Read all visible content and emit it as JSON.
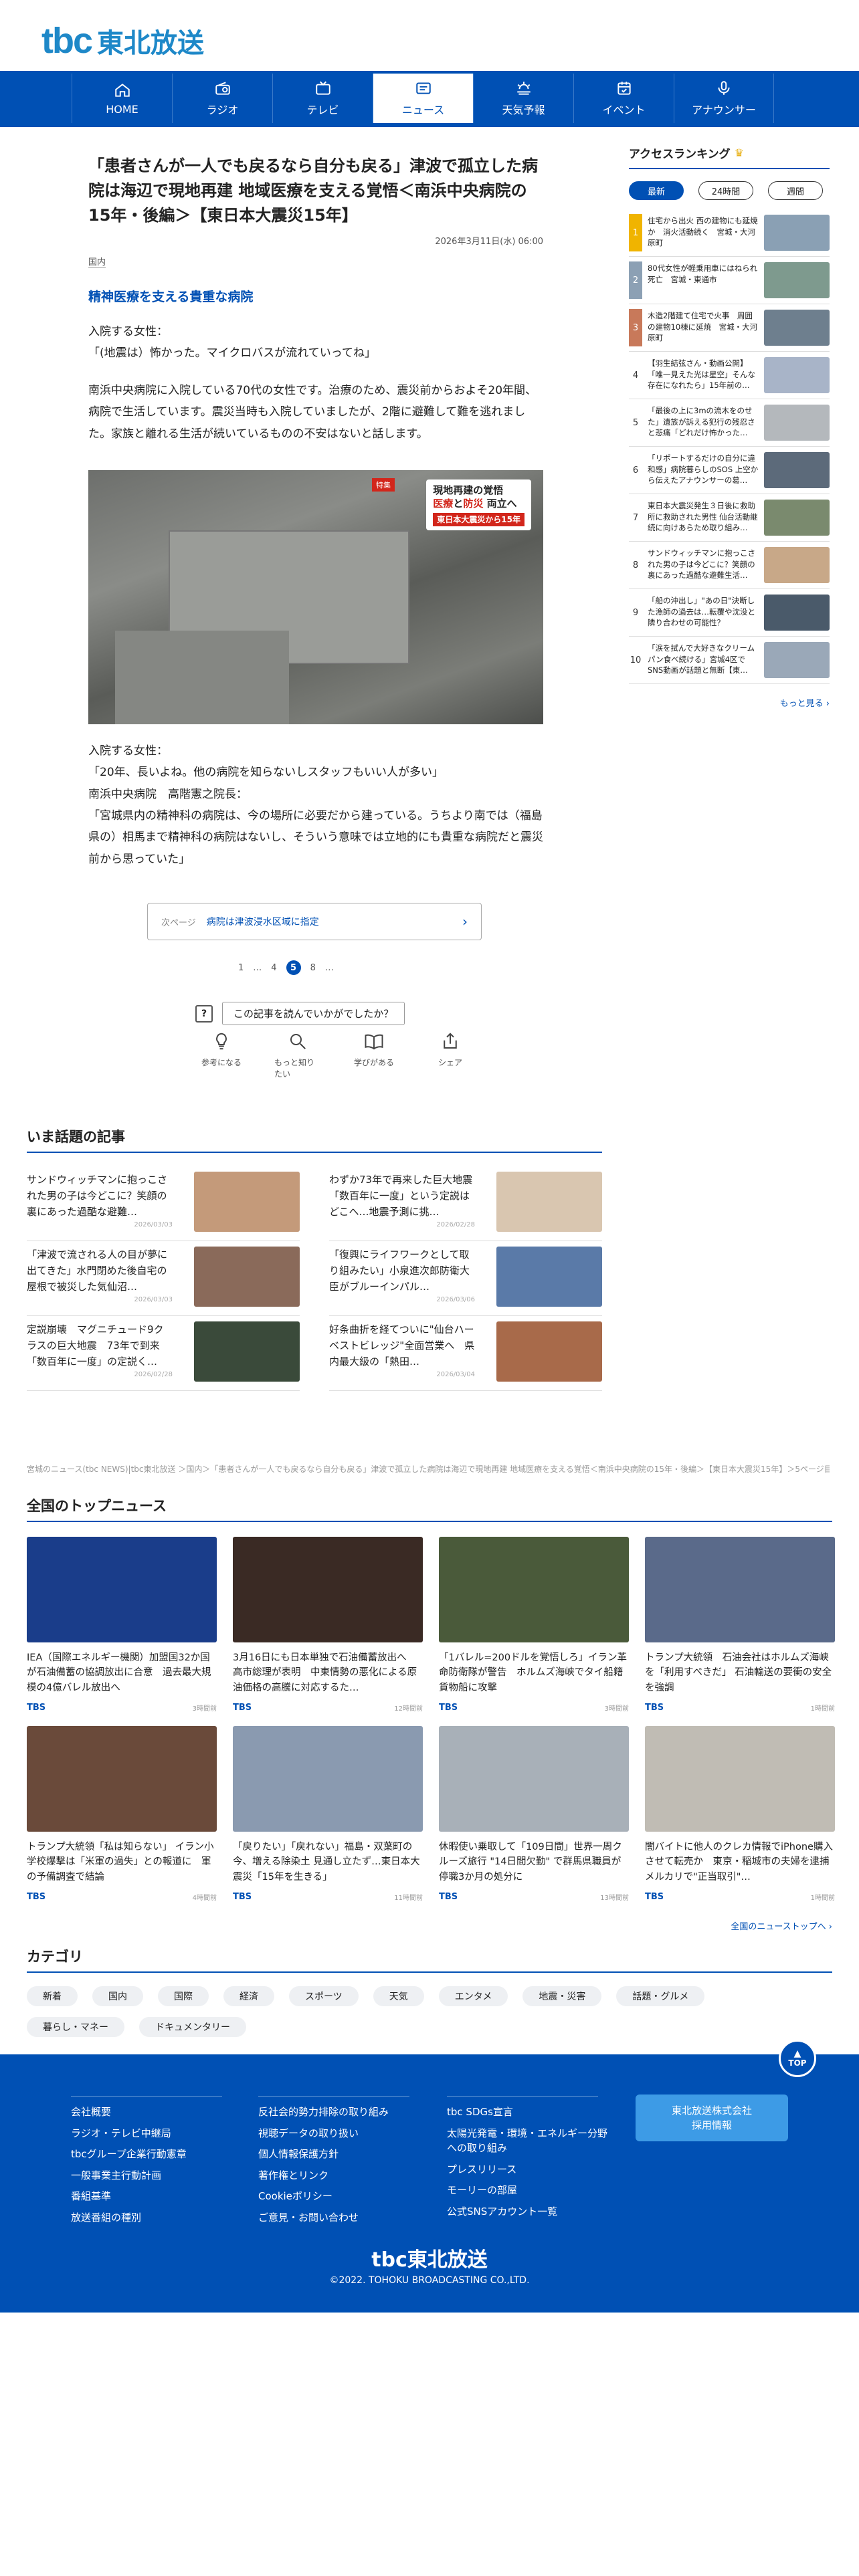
{
  "brand": {
    "logo_mark": "tbc",
    "logo_text": "東北放送"
  },
  "nav": [
    {
      "label": "HOME",
      "icon": "home-icon"
    },
    {
      "label": "ラジオ",
      "icon": "radio-icon"
    },
    {
      "label": "テレビ",
      "icon": "tv-icon"
    },
    {
      "label": "ニュース",
      "icon": "news-icon"
    },
    {
      "label": "天気予報",
      "icon": "weather-icon"
    },
    {
      "label": "イベント",
      "icon": "calendar-icon"
    },
    {
      "label": "アナウンサー",
      "icon": "mic-icon"
    }
  ],
  "article": {
    "title": "「患者さんが一人でも戻るなら自分も戻る」津波で孤立した病院は海辺で現地再建 地域医療を支える覚悟＜南浜中央病院の15年・後編＞【東日本大震災15年】",
    "date": "2026年3月11日(水) 06:00",
    "category": "国内",
    "subheading": "精神医療を支える貴重な病院",
    "quote1": "入院する女性：\n「(地震は）怖かった。マイクロバスが流れていってね」",
    "para1": "南浜中央病院に入院している70代の女性です。治療のため、震災前からおよそ20年間、病院で生活しています。震災当時も入院していましたが、2階に避難して難を逃れました。家族と離れる生活が続いているものの不安はないと話します。",
    "photo_caption_line1": "現地再建の覚悟",
    "photo_caption_line2a": "医療",
    "photo_caption_line2b": "と",
    "photo_caption_line2c": "防災",
    "photo_caption_line2d": " 両立へ",
    "photo_band": "東日本大震災から15年",
    "photo_tag": "特集",
    "quote2": "入院する女性：\n「20年、長いよね。他の病院を知らないしスタッフもいい人が多い」\n南浜中央病院　高階憲之院長：\n「宮城県内の精神科の病院は、今の場所に必要だから建っている。うちより南では（福島県の）相馬まで精神科の病院はないし、そういう意味では立地的にも貴重な病院だと震災前から思っていた」"
  },
  "next": {
    "label": "次ページ",
    "title": "病院は津波浸水区域に指定"
  },
  "pager": {
    "p1": "1",
    "dots1": "…",
    "p4": "4",
    "current": "5",
    "p8": "8",
    "dots2": "…"
  },
  "question": {
    "icon_text": "?",
    "text": "この記事を読んでいかがでしたか？"
  },
  "reactions": [
    {
      "label": "参考になる",
      "icon": "lightbulb-icon"
    },
    {
      "label": "もっと知りたい",
      "icon": "search-icon"
    },
    {
      "label": "学びがある",
      "icon": "book-icon"
    },
    {
      "label": "シェア",
      "icon": "share-icon"
    }
  ],
  "ranking": {
    "title": "アクセスランキング",
    "tabs": [
      "最新",
      "24時間",
      "週間"
    ],
    "items": [
      {
        "n": "1",
        "text": "住宅から出火 西の建物にも延焼か　消火活動続く　宮城・大河原町",
        "thumb": "#8aa0b4"
      },
      {
        "n": "2",
        "text": "80代女性が軽乗用車にはねられ死亡　宮城・東通市",
        "thumb": "#7e9a8e"
      },
      {
        "n": "3",
        "text": "木造2階建て住宅で火事　周囲の建物10棟に延焼　宮城・大河原町",
        "thumb": "#6e7f8e"
      },
      {
        "n": "4",
        "text": "【羽生結弦さん・動画公開】「唯一見えた光は星空」そんな存在になれたら」15年前の…",
        "thumb": "#a8b4c8"
      },
      {
        "n": "5",
        "text": "「最後の上に3mの流木をのせた」遺族が訴える犯行の残忍さと悲痛「どれだけ怖かった…",
        "thumb": "#b4b8bc"
      },
      {
        "n": "6",
        "text": "「リポートするだけの自分に違和感」病院暮らしのSOS 上空から伝えたアナウンサーの葛…",
        "thumb": "#5c6a7a"
      },
      {
        "n": "7",
        "text": "東日本大震災発生３日後に救助所に救助された男性 仙台活動継続に向けあらため取り組み…",
        "thumb": "#7a8a6e"
      },
      {
        "n": "8",
        "text": "サンドウィッチマンに抱っこされた男の子は今どこに？笑顔の裏にあった過酷な避難生活…",
        "thumb": "#c8a888"
      },
      {
        "n": "9",
        "text": "「船の沖出し」\"あの日\"決断した漁師の過去は…転覆や沈没と隣り合わせの可能性？",
        "thumb": "#4a5a6a"
      },
      {
        "n": "10",
        "text": "「涙を拭んで大好きなクリームパン食べ続ける」宮城4区でSNS動画が話題と無断【東…",
        "thumb": "#9aa8b8"
      }
    ],
    "more": "もっと見る ›"
  },
  "hot": {
    "title": "いま話題の記事",
    "items": [
      {
        "text": "サンドウィッチマンに抱っこされた男の子は今どこに？笑顔の裏にあった過酷な避難…",
        "date": "2026/03/03",
        "thumb": "#c49a7a"
      },
      {
        "text": "わずか73年で再来した巨大地震「数百年に一度」という定説はどこへ…地震予測に挑…",
        "date": "2026/02/28",
        "thumb": "#d9c6b0"
      },
      {
        "text": "「津波で流される人の目が夢に出てきた」水門閉めた後自宅の屋根で被災した気仙沼…",
        "date": "2026/03/03",
        "thumb": "#8a6a5a"
      },
      {
        "text": "「復興にライフワークとして取り組みたい」小泉進次郎防衛大臣がブルーインパル…",
        "date": "2026/03/06",
        "thumb": "#5a7aa8"
      },
      {
        "text": "定説崩壊　マグニチュード9クラスの巨大地震　73年で到来「数百年に一度」の定説く…",
        "date": "2026/02/28",
        "thumb": "#3a4a3a"
      },
      {
        "text": "好条曲折を経てついに\"仙台ハーベストビレッジ\"全面営業へ　県内最大級の「熱田…",
        "date": "2026/03/04",
        "thumb": "#a86a4a"
      }
    ]
  },
  "breadcrumb": "宮城のニュース(tbc NEWS)|tbc東北放送 ＞国内＞「患者さんが一人でも戻るなら自分も戻る」津波で孤立した病院は海辺で現地再建 地域医療を支える覚悟＜南浜中央病院の15年・後編＞【東日本大震災15年】＞5ページ目",
  "top_news": {
    "title": "全国のトップニュース",
    "items": [
      {
        "text": "IEA（国際エネルギー機関）加盟国32か国が石油備蓄の協調放出に合意　過去最大規模の4億バレル放出へ",
        "src": "TBS",
        "ago": "3時間前",
        "thumb": "#1a3d8a"
      },
      {
        "text": "3月16日にも日本単独で石油備蓄放出へ　高市総理が表明　中東情勢の悪化による原油価格の高騰に対応するた…",
        "src": "TBS",
        "ago": "12時間前",
        "thumb": "#3a2a24"
      },
      {
        "text": "「1バレル=200ドルを覚悟しろ」イラン革命防衛隊が警告　ホルムズ海峡でタイ船籍貨物船に攻撃",
        "src": "TBS",
        "ago": "3時間前",
        "thumb": "#4a5a3a"
      },
      {
        "text": "トランプ大統領　石油会社はホルムズ海峡を「利用すべきだ」 石油輸送の要衝の安全を強調",
        "src": "TBS",
        "ago": "1時間前",
        "thumb": "#5a6a8a"
      },
      {
        "text": "トランプ大統領「私は知らない」 イラン小学校爆撃は「米軍の過失」との報道に　軍の予備調査で結論",
        "src": "TBS",
        "ago": "4時間前",
        "thumb": "#6a4a3a"
      },
      {
        "text": "「戻りたい」「戻れない」福島・双葉町の今、増える除染土 見通し立たず…東日本大震災「15年を生きる」",
        "src": "TBS",
        "ago": "11時間前",
        "thumb": "#8a9ab0"
      },
      {
        "text": "休暇使い乗取して「109日間」世界一周クルーズ旅行 \"14日間欠勤\" で群馬県職員が停職3か月の処分に",
        "src": "TBS",
        "ago": "13時間前",
        "thumb": "#a8b0b8"
      },
      {
        "text": "闇バイトに他人のクレカ情報でiPhone購入させて転売か　東京・稲城市の夫婦を逮捕　メルカリで\"正当取引\"…",
        "src": "TBS",
        "ago": "1時間前",
        "thumb": "#c0bcb4"
      }
    ],
    "all_link": "全国のニューストップへ ›"
  },
  "categories": {
    "title": "カテゴリ",
    "items": [
      "新着",
      "国内",
      "国際",
      "経済",
      "スポーツ",
      "天気",
      "エンタメ",
      "地震・災害",
      "話題・グルメ",
      "暮らし・マネー",
      "ドキュメンタリー"
    ]
  },
  "footer": {
    "to_top": "TOP",
    "col1": [
      "会社概要",
      "ラジオ・テレビ中継局",
      "tbcグループ企業行動憲章",
      "一般事業主行動計画",
      "番組基準",
      "放送番組の種別"
    ],
    "col2": [
      "反社会的勢力排除の取り組み",
      "視聴データの取り扱い",
      "個人情報保護方針",
      "著作権とリンク",
      "Cookieポリシー",
      "ご意見・お問い合わせ"
    ],
    "col3": [
      "tbc SDGs宣言",
      "太陽光発電・環境・エネルギー分野への取り組み",
      "プレスリリース",
      "モーリーの部屋",
      "公式SNSアカウント一覧"
    ],
    "recruit": "東北放送株式会社\n採用情報",
    "logo": "tbc東北放送",
    "copyright": "©2022. TOHOKU BROADCASTING CO.,LTD."
  },
  "colors": {
    "brand_blue": "#0050b4",
    "logo_blue": "#1e88c8",
    "accent_red": "#d2261b",
    "rank_gold": "#f0b400"
  }
}
